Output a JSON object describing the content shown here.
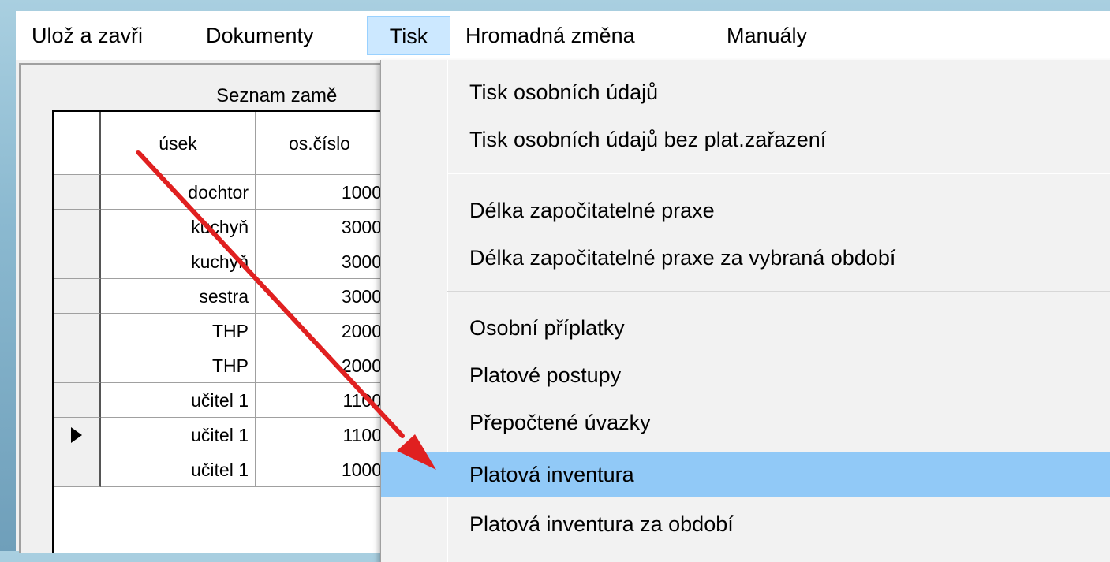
{
  "menubar": {
    "items": [
      "Ulož a zavři",
      "Dokumenty",
      "Tisk",
      "Hromadná změna",
      "Manuály"
    ],
    "active": "Tisk"
  },
  "grid": {
    "caption": "Seznam zamě",
    "headers": {
      "usek": "úsek",
      "os": "os.číslo"
    },
    "rows": [
      {
        "usek": "dochtor",
        "os": "1000"
      },
      {
        "usek": "kuchyň",
        "os": "3000"
      },
      {
        "usek": "kuchyň",
        "os": "3000"
      },
      {
        "usek": "sestra",
        "os": "3000"
      },
      {
        "usek": "THP",
        "os": "2000"
      },
      {
        "usek": "THP",
        "os": "2000"
      },
      {
        "usek": "učitel 1",
        "os": "1100"
      },
      {
        "usek": "učitel 1",
        "os": "1100"
      },
      {
        "usek": "učitel 1",
        "os": "1000"
      }
    ],
    "current_row_index": 7
  },
  "dropdown": {
    "items": [
      "Tisk osobních údajů",
      "Tisk osobních údajů bez plat.zařazení",
      "Délka započitatelné praxe",
      "Délka započitatelné praxe za vybraná období",
      "Osobní příplatky",
      "Platové postupy",
      "Přepočtené úvazky",
      "Platová inventura",
      "Platová inventura za období"
    ],
    "highlighted": "Platová inventura"
  },
  "colors": {
    "highlight": "#91c9f7",
    "menu_active": "#cce8ff",
    "annotation_arrow": "#e02020"
  }
}
